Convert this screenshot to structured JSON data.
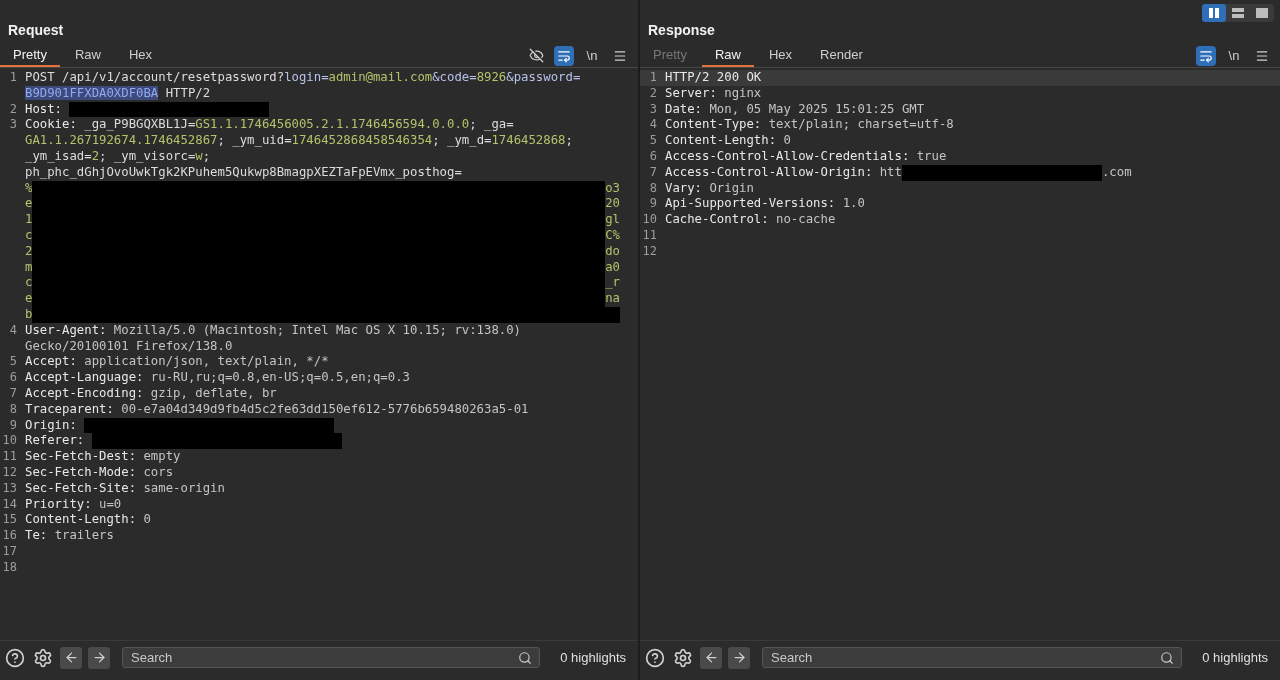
{
  "layout_toggles": [
    {
      "kind": "columns",
      "selected": true
    },
    {
      "kind": "rows",
      "selected": false
    },
    {
      "kind": "single",
      "selected": false
    }
  ],
  "request": {
    "title": "Request",
    "tabs": [
      {
        "label": "Pretty",
        "selected": true,
        "disabled": false
      },
      {
        "label": "Raw",
        "selected": false,
        "disabled": false
      },
      {
        "label": "Hex",
        "selected": false,
        "disabled": false
      }
    ],
    "tools": [
      {
        "kind": "hide",
        "on": false
      },
      {
        "kind": "wrap",
        "on": true
      },
      {
        "kind": "newline",
        "label": "\\n",
        "on": false
      },
      {
        "kind": "menu",
        "on": false
      }
    ],
    "lines": [
      {
        "number": "1",
        "rows": [
          {
            "parts": [
              {
                "kind": "text",
                "text": "POST /api/v1/account/resetpassword?"
              },
              {
                "kind": "param",
                "text": "login="
              },
              {
                "kind": "value",
                "text": "admin@mail.com"
              },
              {
                "kind": "param",
                "text": "&code="
              },
              {
                "kind": "value",
                "text": "8926"
              },
              {
                "kind": "param",
                "text": "&password="
              }
            ]
          },
          {
            "parts": [
              {
                "kind": "selected",
                "text": "B9D901FFXDA0XDF0BA"
              },
              {
                "kind": "text",
                "text": " HTTP/2"
              }
            ]
          }
        ]
      },
      {
        "number": "2",
        "rows": [
          {
            "parts": [
              {
                "kind": "name",
                "text": "Host: "
              },
              {
                "kind": "redaction"
              }
            ]
          }
        ]
      },
      {
        "number": "3",
        "rows": [
          {
            "parts": [
              {
                "kind": "name",
                "text": "Cookie: "
              },
              {
                "kind": "text",
                "text": "_ga_P9BGQXBL1J="
              },
              {
                "kind": "value",
                "text": "GS1.1.1746456005.2.1.1746456594.0.0.0"
              },
              {
                "kind": "text",
                "text": "; _ga="
              }
            ]
          },
          {
            "parts": [
              {
                "kind": "value",
                "text": "GA1.1.267192674.1746452867"
              },
              {
                "kind": "text",
                "text": "; _ym_uid="
              },
              {
                "kind": "value",
                "text": "1746452868458546354"
              },
              {
                "kind": "text",
                "text": "; _ym_d="
              },
              {
                "kind": "value",
                "text": "1746452868"
              },
              {
                "kind": "text",
                "text": ";"
              }
            ]
          },
          {
            "parts": [
              {
                "kind": "text",
                "text": "_ym_isad="
              },
              {
                "kind": "value",
                "text": "2"
              },
              {
                "kind": "text",
                "text": "; _ym_visorc="
              },
              {
                "kind": "value",
                "text": "w"
              },
              {
                "kind": "text",
                "text": ";"
              }
            ]
          },
          {
            "parts": [
              {
                "kind": "text",
                "text": "ph_phc_dGhjOvoUwkTgk2KPuhem5Qukwp8BmagpXEZTaFpEVmx_posthog="
              }
            ]
          },
          {
            "parts": [
              {
                "kind": "value",
                "text": "%"
              },
              {
                "kind": "redaction_fill"
              },
              {
                "kind": "value",
                "text": "o3"
              }
            ]
          },
          {
            "parts": [
              {
                "kind": "value",
                "text": "e"
              },
              {
                "kind": "redaction_fill"
              },
              {
                "kind": "value",
                "text": "20"
              }
            ]
          },
          {
            "parts": [
              {
                "kind": "value",
                "text": "1"
              },
              {
                "kind": "redaction_fill"
              },
              {
                "kind": "value",
                "text": "gl"
              }
            ]
          },
          {
            "parts": [
              {
                "kind": "value",
                "text": "c"
              },
              {
                "kind": "redaction_fill"
              },
              {
                "kind": "value",
                "text": "C%"
              }
            ]
          },
          {
            "parts": [
              {
                "kind": "value",
                "text": "2"
              },
              {
                "kind": "redaction_fill"
              },
              {
                "kind": "value",
                "text": "do"
              }
            ]
          },
          {
            "parts": [
              {
                "kind": "value",
                "text": "m"
              },
              {
                "kind": "redaction_fill"
              },
              {
                "kind": "value",
                "text": "a0"
              }
            ]
          },
          {
            "parts": [
              {
                "kind": "value",
                "text": "c"
              },
              {
                "kind": "redaction_fill"
              },
              {
                "kind": "value",
                "text": "_r"
              }
            ]
          },
          {
            "parts": [
              {
                "kind": "value",
                "text": "e"
              },
              {
                "kind": "redaction_fill"
              },
              {
                "kind": "value",
                "text": "na"
              }
            ]
          },
          {
            "parts": [
              {
                "kind": "value",
                "text": "b"
              },
              {
                "kind": "redaction_fill"
              }
            ]
          }
        ]
      },
      {
        "number": "4",
        "rows": [
          {
            "parts": [
              {
                "kind": "name",
                "text": "User-Agent: "
              },
              {
                "kind": "header",
                "text": "Mozilla/5.0 (Macintosh; Intel Mac OS X 10.15; rv:138.0)"
              }
            ]
          },
          {
            "parts": [
              {
                "kind": "header",
                "text": "Gecko/20100101 Firefox/138.0"
              }
            ]
          }
        ]
      },
      {
        "number": "5",
        "rows": [
          {
            "parts": [
              {
                "kind": "name",
                "text": "Accept: "
              },
              {
                "kind": "header",
                "text": "application/json, text/plain, */*"
              }
            ]
          }
        ]
      },
      {
        "number": "6",
        "rows": [
          {
            "parts": [
              {
                "kind": "name",
                "text": "Accept-Language: "
              },
              {
                "kind": "header",
                "text": "ru-RU,ru;q=0.8,en-US;q=0.5,en;q=0.3"
              }
            ]
          }
        ]
      },
      {
        "number": "7",
        "rows": [
          {
            "parts": [
              {
                "kind": "name",
                "text": "Accept-Encoding: "
              },
              {
                "kind": "header",
                "text": "gzip, deflate, br"
              }
            ]
          }
        ]
      },
      {
        "number": "8",
        "rows": [
          {
            "parts": [
              {
                "kind": "name",
                "text": "Traceparent: "
              },
              {
                "kind": "header",
                "text": "00-e7a04d349d9fb4d5c2fe63dd150ef612-5776b659480263a5-01"
              }
            ]
          }
        ]
      },
      {
        "number": "9",
        "rows": [
          {
            "parts": [
              {
                "kind": "name",
                "text": "Origin: "
              },
              {
                "kind": "redaction_wide"
              }
            ]
          }
        ]
      },
      {
        "number": "10",
        "rows": [
          {
            "parts": [
              {
                "kind": "name",
                "text": "Referer: "
              },
              {
                "kind": "redaction_wide"
              }
            ]
          }
        ]
      },
      {
        "number": "11",
        "rows": [
          {
            "parts": [
              {
                "kind": "name",
                "text": "Sec-Fetch-Dest: "
              },
              {
                "kind": "header",
                "text": "empty"
              }
            ]
          }
        ]
      },
      {
        "number": "12",
        "rows": [
          {
            "parts": [
              {
                "kind": "name",
                "text": "Sec-Fetch-Mode: "
              },
              {
                "kind": "header",
                "text": "cors"
              }
            ]
          }
        ]
      },
      {
        "number": "13",
        "rows": [
          {
            "parts": [
              {
                "kind": "name",
                "text": "Sec-Fetch-Site: "
              },
              {
                "kind": "header",
                "text": "same-origin"
              }
            ]
          }
        ]
      },
      {
        "number": "14",
        "rows": [
          {
            "parts": [
              {
                "kind": "name",
                "text": "Priority: "
              },
              {
                "kind": "header",
                "text": "u=0"
              }
            ]
          }
        ]
      },
      {
        "number": "15",
        "rows": [
          {
            "parts": [
              {
                "kind": "name",
                "text": "Content-Length: "
              },
              {
                "kind": "header",
                "text": "0"
              }
            ]
          }
        ]
      },
      {
        "number": "16",
        "rows": [
          {
            "parts": [
              {
                "kind": "name",
                "text": "Te: "
              },
              {
                "kind": "header",
                "text": "trailers"
              }
            ]
          }
        ]
      },
      {
        "number": "17"
      },
      {
        "number": "18"
      }
    ],
    "search": {
      "placeholder": "Search"
    },
    "highlights": "0 highlights"
  },
  "response": {
    "title": "Response",
    "tabs": [
      {
        "label": "Pretty",
        "selected": false,
        "disabled": true
      },
      {
        "label": "Raw",
        "selected": true,
        "disabled": false
      },
      {
        "label": "Hex",
        "selected": false,
        "disabled": false
      },
      {
        "label": "Render",
        "selected": false,
        "disabled": false
      }
    ],
    "tools": [
      {
        "kind": "wrap",
        "on": true
      },
      {
        "kind": "newline",
        "label": "\\n",
        "on": false
      },
      {
        "kind": "menu",
        "on": false
      }
    ],
    "lines": [
      {
        "number": "1",
        "current": true,
        "rows": [
          {
            "parts": [
              {
                "kind": "name",
                "text": "HTTP/2 200 OK"
              }
            ]
          }
        ]
      },
      {
        "number": "2",
        "current": false,
        "rows": [
          {
            "parts": [
              {
                "kind": "name",
                "text": "Server: "
              },
              {
                "kind": "header",
                "text": "nginx"
              }
            ]
          }
        ]
      },
      {
        "number": "3",
        "current": false,
        "rows": [
          {
            "parts": [
              {
                "kind": "name",
                "text": "Date: "
              },
              {
                "kind": "header",
                "text": "Mon, 05 May 2025 15:01:25 GMT"
              }
            ]
          }
        ]
      },
      {
        "number": "4",
        "current": false,
        "rows": [
          {
            "parts": [
              {
                "kind": "name",
                "text": "Content-Type: "
              },
              {
                "kind": "header",
                "text": "text/plain; charset=utf-8"
              }
            ]
          }
        ]
      },
      {
        "number": "5",
        "current": false,
        "rows": [
          {
            "parts": [
              {
                "kind": "name",
                "text": "Content-Length: "
              },
              {
                "kind": "header",
                "text": "0"
              }
            ]
          }
        ]
      },
      {
        "number": "6",
        "current": false,
        "rows": [
          {
            "parts": [
              {
                "kind": "name",
                "text": "Access-Control-Allow-Credentials: "
              },
              {
                "kind": "header",
                "text": "true"
              }
            ]
          }
        ]
      },
      {
        "number": "7",
        "current": false,
        "rows": [
          {
            "parts": [
              {
                "kind": "name",
                "text": "Access-Control-Allow-Origin: "
              },
              {
                "kind": "header",
                "text": "htt"
              },
              {
                "kind": "redaction"
              },
              {
                "kind": "header",
                "text": ".com"
              }
            ]
          }
        ]
      },
      {
        "number": "8",
        "current": false,
        "rows": [
          {
            "parts": [
              {
                "kind": "name",
                "text": "Vary: "
              },
              {
                "kind": "header",
                "text": "Origin"
              }
            ]
          }
        ]
      },
      {
        "number": "9",
        "current": false,
        "rows": [
          {
            "parts": [
              {
                "kind": "name",
                "text": "Api-Supported-Versions: "
              },
              {
                "kind": "header",
                "text": "1.0"
              }
            ]
          }
        ]
      },
      {
        "number": "10",
        "current": false,
        "rows": [
          {
            "parts": [
              {
                "kind": "name",
                "text": "Cache-Control: "
              },
              {
                "kind": "header",
                "text": "no-cache"
              }
            ]
          }
        ]
      },
      {
        "number": "11",
        "current": false
      },
      {
        "number": "12",
        "current": false
      }
    ],
    "search": {
      "placeholder": "Search"
    },
    "highlights": "0 highlights"
  }
}
